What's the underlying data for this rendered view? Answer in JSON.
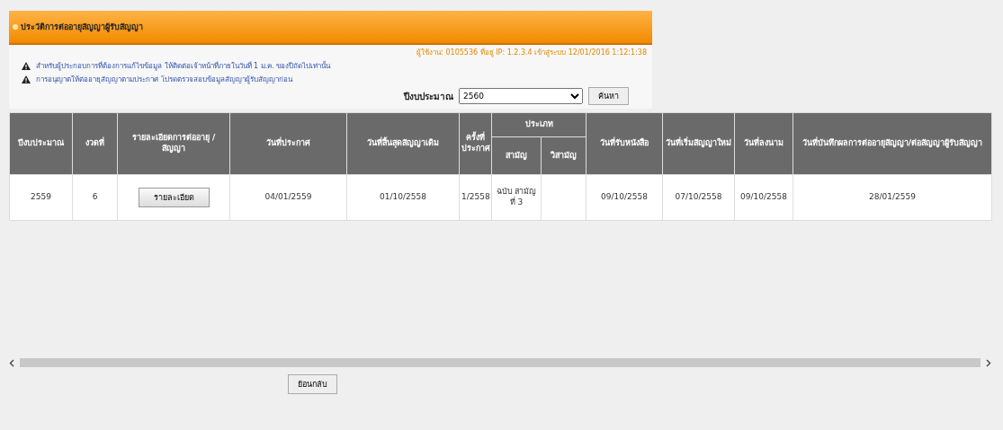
{
  "header": {
    "title": "ประวัติการต่ออายุสัญญาผู้รับสัญญา",
    "user_info": "ผู้ใช้งาน: 0105536 ที่อยู่ IP: 1.2.3.4 เข้าสู่ระบบ 12/01/2016 1:12:1:38"
  },
  "notices": [
    {
      "text": "สำหรับผู้ประกอบการที่ต้องการแก้ไขข้อมูล ให้ติดต่อเจ้าหน้าที่ภายในวันที่ 1 ม.ค. ของปีถัดไปเท่านั้น"
    },
    {
      "text": "การอนุญาตให้ต่ออายุสัญญาตามประกาศ โปรดตรวจสอบข้อมูลสัญญาผู้รับสัญญาก่อน"
    }
  ],
  "filter": {
    "label": "ปีงบประมาณ",
    "value": "2560",
    "button": "ค้นหา"
  },
  "table": {
    "columns": [
      {
        "label": "ปีงบประมาณ"
      },
      {
        "label": "งวดที่"
      },
      {
        "label": "รายละเอียดการต่ออายุ / สัญญา"
      },
      {
        "label": "วันที่ประกาศ"
      },
      {
        "label": "วันที่สิ้นสุดสัญญาเดิม"
      },
      {
        "label": "ครั้งที่ประกาศ"
      },
      {
        "label": "สามัญ",
        "group_label": "ประเภท",
        "in_group": true
      },
      {
        "label": "วิสามัญ",
        "in_group": true
      },
      {
        "label": "วันที่รับหนังสือ"
      },
      {
        "label": "วันที่เริ่มสัญญาใหม่"
      },
      {
        "label": "วันที่ลงนาม"
      },
      {
        "label": "วันที่บันทึกผลการต่ออายุสัญญา/ต่อสัญญาผู้รับสัญญา"
      }
    ],
    "rows": [
      {
        "cells": [
          {
            "kind": "text",
            "text": "2559"
          },
          {
            "kind": "text",
            "text": "6"
          },
          {
            "kind": "button",
            "text": "รายละเอียด"
          },
          {
            "kind": "text",
            "text": "04/01/2559"
          },
          {
            "kind": "text",
            "text": "01/10/2558"
          },
          {
            "kind": "text",
            "text": "1/2558"
          },
          {
            "kind": "text",
            "text": "ฉบับ สามัญที่ 3"
          },
          {
            "kind": "empty"
          },
          {
            "kind": "text",
            "text": "09/10/2558"
          },
          {
            "kind": "text",
            "text": "07/10/2558"
          },
          {
            "kind": "text",
            "text": "09/10/2558"
          },
          {
            "kind": "text",
            "text": "28/01/2559"
          }
        ]
      }
    ]
  },
  "back_button": "ย้อนกลับ"
}
